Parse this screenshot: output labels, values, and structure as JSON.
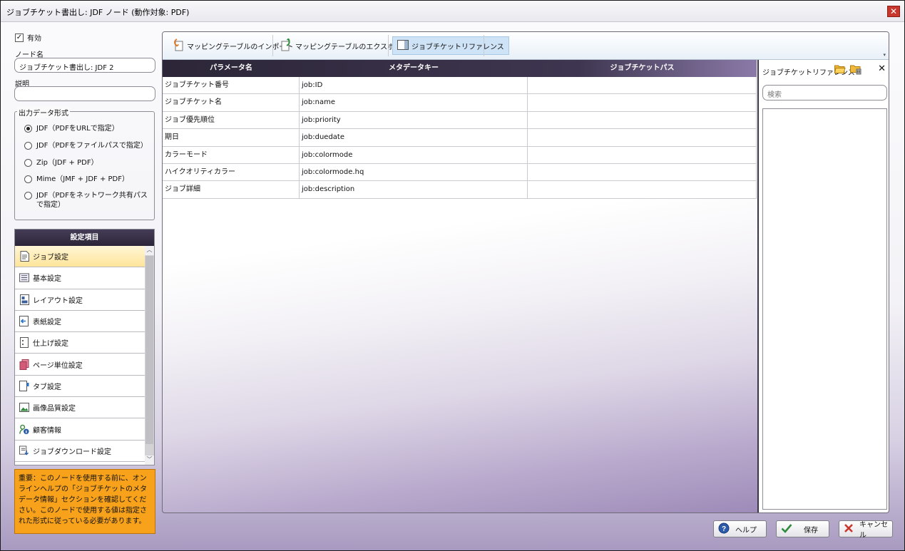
{
  "window": {
    "title": "ジョブチケット書出し: JDF ノード (動作対象: PDF)",
    "close": "✕"
  },
  "enabled": {
    "label": "有効",
    "checked": true,
    "check_mark": "✓"
  },
  "node_name": {
    "label": "ノード名",
    "value": "ジョブチケット書出し: JDF 2"
  },
  "description": {
    "label": "説明",
    "value": ""
  },
  "output_format": {
    "legend": "出力データ形式",
    "options": [
      {
        "label": "JDF（PDFをURLで指定）",
        "selected": true
      },
      {
        "label": "JDF（PDFをファイルパスで指定）",
        "selected": false
      },
      {
        "label": "Zip（JDF + PDF）",
        "selected": false
      },
      {
        "label": "Mime（JMF + JDF + PDF）",
        "selected": false
      },
      {
        "label": "JDF（PDFをネットワーク共有パスで指定）",
        "selected": false
      }
    ]
  },
  "settings": {
    "header": "設定項目",
    "items": [
      {
        "label": "ジョブ設定",
        "icon": "document-icon",
        "selected": true
      },
      {
        "label": "基本設定",
        "icon": "list-icon"
      },
      {
        "label": "レイアウト設定",
        "icon": "layout-icon"
      },
      {
        "label": "表紙設定",
        "icon": "cover-icon"
      },
      {
        "label": "仕上げ設定",
        "icon": "finishing-icon"
      },
      {
        "label": "ページ単位設定",
        "icon": "pages-icon"
      },
      {
        "label": "タブ設定",
        "icon": "tab-icon"
      },
      {
        "label": "画像品質設定",
        "icon": "image-icon"
      },
      {
        "label": "顧客情報",
        "icon": "customer-icon"
      },
      {
        "label": "ジョブダウンロード設定",
        "icon": "download-icon"
      }
    ]
  },
  "notice": "重要：このノードを使用する前に、オンラインヘルプの「ジョブチケットのメタデータ情報」セクションを確認してください。このノードで使用する値は指定された形式に従っている必要があります。",
  "toolbar": {
    "import": "マッピングテーブルのインポート",
    "export": "マッピングテーブルのエクスポート",
    "reference": "ジョブチケットリファレンス",
    "caret": "▾"
  },
  "grid": {
    "headers": [
      "パラメータ名",
      "メタデータキー",
      "ジョブチケットパス"
    ],
    "rows": [
      [
        "ジョブチケット番号",
        "job:ID",
        ""
      ],
      [
        "ジョブチケット名",
        "job:name",
        ""
      ],
      [
        "ジョブ優先順位",
        "job:priority",
        ""
      ],
      [
        "期日",
        "job:duedate",
        ""
      ],
      [
        "カラーモード",
        "job:colormode",
        ""
      ],
      [
        "ハイクオリティカラー",
        "job:colormode.hq",
        ""
      ],
      [
        "ジョブ詳細",
        "job:description",
        ""
      ]
    ]
  },
  "reference_panel": {
    "title": "ジョブチケットリファレンス",
    "search_placeholder": "検索",
    "close": "✕"
  },
  "buttons": {
    "help": "ヘルプ",
    "save": "保存",
    "cancel": "キャンセル"
  },
  "colors": {
    "accent_dark": "#2c2638",
    "notice_bg": "#f7a21a",
    "selected_item": "#ffe59a"
  }
}
